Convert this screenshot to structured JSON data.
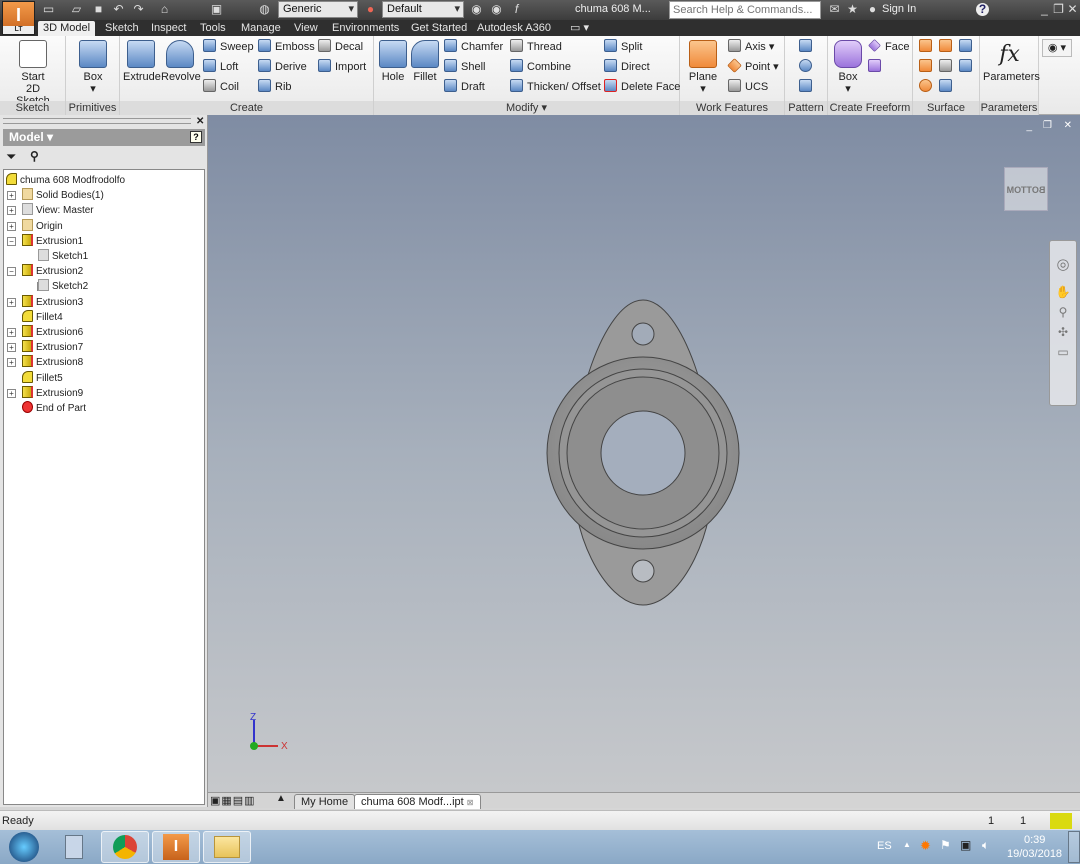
{
  "app": {
    "logo_text": "I",
    "logo_sub": "LT",
    "doc_title": "chuma 608 M...",
    "search_placeholder": "Search Help & Commands...",
    "sign_in": "Sign In",
    "material": "Generic",
    "appearance": "Default"
  },
  "tabs": [
    "3D Model",
    "Sketch",
    "Inspect",
    "Tools",
    "Manage",
    "View",
    "Environments",
    "Get Started",
    "Autodesk A360"
  ],
  "ribbon": {
    "sketch": {
      "label": "Sketch",
      "start": "Start",
      "start2": "2D Sketch"
    },
    "primitives": {
      "label": "Primitives",
      "box": "Box"
    },
    "create": {
      "label": "Create",
      "extrude": "Extrude",
      "revolve": "Revolve",
      "sweep": "Sweep",
      "loft": "Loft",
      "coil": "Coil",
      "emboss": "Emboss",
      "derive": "Derive",
      "rib": "Rib",
      "decal": "Decal",
      "import": "Import"
    },
    "modify": {
      "label": "Modify ▾",
      "hole": "Hole",
      "fillet": "Fillet",
      "chamfer": "Chamfer",
      "shell": "Shell",
      "draft": "Draft",
      "thread": "Thread",
      "combine": "Combine",
      "thicken": "Thicken/ Offset",
      "split": "Split",
      "direct": "Direct",
      "delete_face": "Delete Face"
    },
    "work": {
      "label": "Work Features",
      "plane": "Plane",
      "axis": "Axis ▾",
      "point": "Point ▾",
      "ucs": "UCS"
    },
    "pattern": {
      "label": "Pattern"
    },
    "freeform": {
      "label": "Create Freeform",
      "box": "Box",
      "face": "Face"
    },
    "surface": {
      "label": "Surface"
    },
    "parameters": {
      "label": "Parameters",
      "button": "Parameters",
      "fx": "fx"
    }
  },
  "browser": {
    "title": "Model ▾",
    "help": "?",
    "items": [
      {
        "label": "chuma 608 Modfrodolfo",
        "icon": "part"
      },
      {
        "label": "Solid Bodies(1)",
        "icon": "folder"
      },
      {
        "label": "View: Master",
        "icon": "view"
      },
      {
        "label": "Origin",
        "icon": "folder"
      },
      {
        "label": "Extrusion1",
        "icon": "extrusion"
      },
      {
        "label": "Sketch1",
        "icon": "sketch"
      },
      {
        "label": "Extrusion2",
        "icon": "extrusion"
      },
      {
        "label": "Sketch2",
        "icon": "sketch"
      },
      {
        "label": "Extrusion3",
        "icon": "extrusion"
      },
      {
        "label": "Fillet4",
        "icon": "fillet"
      },
      {
        "label": "Extrusion6",
        "icon": "extrusion"
      },
      {
        "label": "Extrusion7",
        "icon": "extrusion"
      },
      {
        "label": "Extrusion8",
        "icon": "extrusion"
      },
      {
        "label": "Fillet5",
        "icon": "fillet"
      },
      {
        "label": "Extrusion9",
        "icon": "extrusion"
      },
      {
        "label": "End of Part",
        "icon": "end"
      }
    ]
  },
  "viewport": {
    "viewcube": "BOTTOM",
    "axis_z": "Z",
    "axis_x": "X"
  },
  "doc_tabs": [
    "My Home",
    "chuma 608 Modf...ipt"
  ],
  "status": {
    "text": "Ready",
    "val1": "1",
    "val2": "1"
  },
  "taskbar": {
    "lang": "ES",
    "time": "0:39",
    "date": "19/03/2018"
  }
}
